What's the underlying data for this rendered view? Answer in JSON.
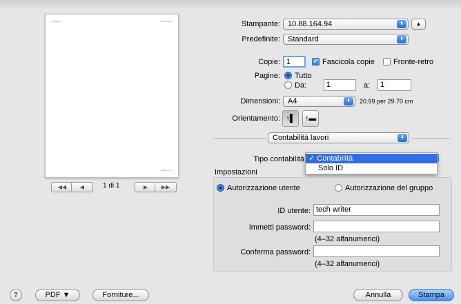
{
  "preview": {
    "header_left": "Stampante",
    "header_right": "10.88.164.94",
    "footer_right": "Pagina 1 di 1",
    "page_indicator": "1 di 1",
    "first_btn": "◀◀",
    "prev_btn": "◀",
    "next_btn": "▶",
    "last_btn": "▶▶"
  },
  "printer": {
    "label": "Stampante:",
    "value": "10.88.164.94"
  },
  "presets": {
    "label": "Predefinite:",
    "value": "Standard"
  },
  "copies": {
    "label": "Copie:",
    "value": "1",
    "collate_label": "Fascicola copie",
    "collate_checked": true,
    "duplex_label": "Fronte-retro",
    "duplex_checked": false
  },
  "pages": {
    "label": "Pagine:",
    "all_label": "Tutto",
    "from_label": "Da:",
    "from_value": "1",
    "to_label": "a:",
    "to_value": "1",
    "selected": "all"
  },
  "paper": {
    "label": "Dimensioni:",
    "value": "A4",
    "size_text": "20.99 per 29.70 cm"
  },
  "orientation": {
    "label": "Orientamento:"
  },
  "section_popup": {
    "value": "Contabilità lavori"
  },
  "accounting": {
    "label": "Tipo contabilità:",
    "menu_items": [
      "✓ Contabilità",
      "Solo ID"
    ],
    "selected_index": 0
  },
  "settings": {
    "title": "Impostazioni",
    "radio_user": "Autorizzazione utente",
    "radio_group": "Autorizzazione del gruppo",
    "selected": "user",
    "user_id_label": "ID utente:",
    "user_id_value": "tech writer",
    "password_label": "Immetti password:",
    "password_hint": "(4–32 alfanumerici)",
    "confirm_label": "Conferma password:",
    "confirm_hint": "(4–32 alfanumerici)"
  },
  "footer": {
    "help": "?",
    "pdf_label": "PDF ▼",
    "supplies_label": "Forniture...",
    "cancel_label": "Annulla",
    "print_label": "Stampa"
  }
}
